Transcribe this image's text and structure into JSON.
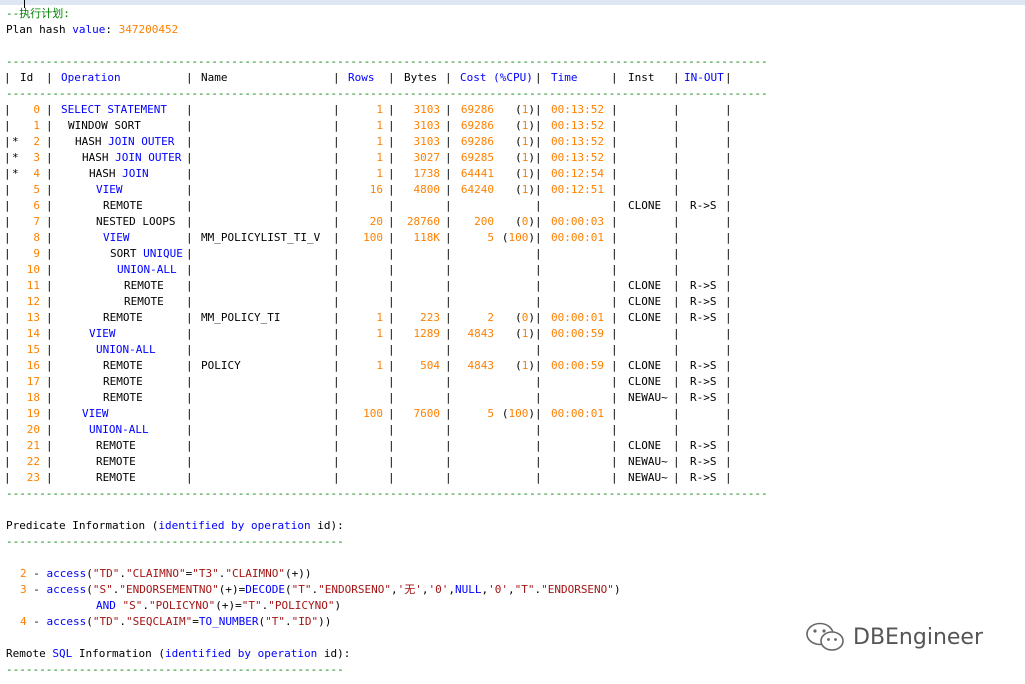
{
  "editor": {
    "comment": "--执行计划:",
    "plan_hash_label": "Plan hash ",
    "plan_hash_keyword": "value",
    "plan_hash_colon": ": ",
    "plan_hash_value": "347200452",
    "separator": "-------------------------------------------------------------------------------------------------------------------",
    "headers": [
      "Id",
      "Operation",
      "Name",
      "Rows",
      "Bytes",
      "Cost (%CPU)",
      "Time",
      "Inst",
      "IN-OUT"
    ],
    "rows": [
      {
        "star": "",
        "id": "0",
        "op": "SELECT STATEMENT",
        "indent": 0,
        "name": "",
        "rows": "1",
        "bytes": "3103",
        "cost": "69286",
        "cpu": "(1)",
        "time": "00:13:52",
        "inst": "",
        "inout": ""
      },
      {
        "star": "",
        "id": "1",
        "op": "WINDOW SORT",
        "indent": 1,
        "name": "",
        "rows": "1",
        "bytes": "3103",
        "cost": "69286",
        "cpu": "(1)",
        "time": "00:13:52",
        "inst": "",
        "inout": ""
      },
      {
        "star": "*",
        "id": "2",
        "op": "HASH JOIN OUTER",
        "indent": 2,
        "name": "",
        "rows": "1",
        "bytes": "3103",
        "cost": "69286",
        "cpu": "(1)",
        "time": "00:13:52",
        "inst": "",
        "inout": ""
      },
      {
        "star": "*",
        "id": "3",
        "op": "HASH JOIN OUTER",
        "indent": 3,
        "name": "",
        "rows": "1",
        "bytes": "3027",
        "cost": "69285",
        "cpu": "(1)",
        "time": "00:13:52",
        "inst": "",
        "inout": ""
      },
      {
        "star": "*",
        "id": "4",
        "op": "HASH JOIN",
        "indent": 4,
        "name": "",
        "rows": "1",
        "bytes": "1738",
        "cost": "64441",
        "cpu": "(1)",
        "time": "00:12:54",
        "inst": "",
        "inout": ""
      },
      {
        "star": "",
        "id": "5",
        "op": "VIEW",
        "indent": 5,
        "name": "",
        "rows": "16",
        "bytes": "4800",
        "cost": "64240",
        "cpu": "(1)",
        "time": "00:12:51",
        "inst": "",
        "inout": ""
      },
      {
        "star": "",
        "id": "6",
        "op": "REMOTE",
        "indent": 6,
        "name": "",
        "rows": "",
        "bytes": "",
        "cost": "",
        "cpu": "",
        "time": "",
        "inst": "CLONE",
        "inout": "R->S"
      },
      {
        "star": "",
        "id": "7",
        "op": "NESTED LOOPS",
        "indent": 5,
        "name": "",
        "rows": "20",
        "bytes": "28760",
        "cost": "200",
        "cpu": "(0)",
        "time": "00:00:03",
        "inst": "",
        "inout": ""
      },
      {
        "star": "",
        "id": "8",
        "op": "VIEW",
        "indent": 6,
        "name": "MM_POLICYLIST_TI_V",
        "rows": "100",
        "bytes": "118K",
        "cost": "5",
        "cpu": "(100)",
        "time": "00:00:01",
        "inst": "",
        "inout": ""
      },
      {
        "star": "",
        "id": "9",
        "op": "SORT UNIQUE",
        "indent": 7,
        "name": "",
        "rows": "",
        "bytes": "",
        "cost": "",
        "cpu": "",
        "time": "",
        "inst": "",
        "inout": ""
      },
      {
        "star": "",
        "id": "10",
        "op": "UNION-ALL",
        "indent": 8,
        "name": "",
        "rows": "",
        "bytes": "",
        "cost": "",
        "cpu": "",
        "time": "",
        "inst": "",
        "inout": ""
      },
      {
        "star": "",
        "id": "11",
        "op": "REMOTE",
        "indent": 9,
        "name": "",
        "rows": "",
        "bytes": "",
        "cost": "",
        "cpu": "",
        "time": "",
        "inst": "CLONE",
        "inout": "R->S"
      },
      {
        "star": "",
        "id": "12",
        "op": "REMOTE",
        "indent": 9,
        "name": "",
        "rows": "",
        "bytes": "",
        "cost": "",
        "cpu": "",
        "time": "",
        "inst": "CLONE",
        "inout": "R->S"
      },
      {
        "star": "",
        "id": "13",
        "op": "REMOTE",
        "indent": 6,
        "name": "MM_POLICY_TI",
        "rows": "1",
        "bytes": "223",
        "cost": "2",
        "cpu": "(0)",
        "time": "00:00:01",
        "inst": "CLONE",
        "inout": "R->S"
      },
      {
        "star": "",
        "id": "14",
        "op": "VIEW",
        "indent": 4,
        "name": "",
        "rows": "1",
        "bytes": "1289",
        "cost": "4843",
        "cpu": "(1)",
        "time": "00:00:59",
        "inst": "",
        "inout": ""
      },
      {
        "star": "",
        "id": "15",
        "op": "UNION-ALL",
        "indent": 5,
        "name": "",
        "rows": "",
        "bytes": "",
        "cost": "",
        "cpu": "",
        "time": "",
        "inst": "",
        "inout": ""
      },
      {
        "star": "",
        "id": "16",
        "op": "REMOTE",
        "indent": 6,
        "name": "POLICY",
        "rows": "1",
        "bytes": "504",
        "cost": "4843",
        "cpu": "(1)",
        "time": "00:00:59",
        "inst": "CLONE",
        "inout": "R->S"
      },
      {
        "star": "",
        "id": "17",
        "op": "REMOTE",
        "indent": 6,
        "name": "",
        "rows": "",
        "bytes": "",
        "cost": "",
        "cpu": "",
        "time": "",
        "inst": "CLONE",
        "inout": "R->S"
      },
      {
        "star": "",
        "id": "18",
        "op": "REMOTE",
        "indent": 6,
        "name": "",
        "rows": "",
        "bytes": "",
        "cost": "",
        "cpu": "",
        "time": "",
        "inst": "NEWAU~",
        "inout": "R->S"
      },
      {
        "star": "",
        "id": "19",
        "op": "VIEW",
        "indent": 3,
        "name": "",
        "rows": "100",
        "bytes": "7600",
        "cost": "5",
        "cpu": "(100)",
        "time": "00:00:01",
        "inst": "",
        "inout": ""
      },
      {
        "star": "",
        "id": "20",
        "op": "UNION-ALL",
        "indent": 4,
        "name": "",
        "rows": "",
        "bytes": "",
        "cost": "",
        "cpu": "",
        "time": "",
        "inst": "",
        "inout": ""
      },
      {
        "star": "",
        "id": "21",
        "op": "REMOTE",
        "indent": 5,
        "name": "",
        "rows": "",
        "bytes": "",
        "cost": "",
        "cpu": "",
        "time": "",
        "inst": "CLONE",
        "inout": "R->S"
      },
      {
        "star": "",
        "id": "22",
        "op": "REMOTE",
        "indent": 5,
        "name": "",
        "rows": "",
        "bytes": "",
        "cost": "",
        "cpu": "",
        "time": "",
        "inst": "NEWAU~",
        "inout": "R->S"
      },
      {
        "star": "",
        "id": "23",
        "op": "REMOTE",
        "indent": 5,
        "name": "",
        "rows": "",
        "bytes": "",
        "cost": "",
        "cpu": "",
        "time": "",
        "inst": "NEWAU~",
        "inout": "R->S"
      }
    ],
    "predicate_title_a": "Predicate Information (",
    "predicate_title_kw": "identified by operation",
    "predicate_title_b": " id):",
    "short_separator": "---------------------------------------------------",
    "predicates": [
      {
        "n": "2",
        "text_a": "access",
        "text_b": "(\"TD\".\"CLAIMNO\"=\"T3\".\"CLAIMNO\"(+))"
      },
      {
        "n": "3",
        "text_a": "access",
        "text_b": "(\"S\".\"ENDORSEMENTNO\"(+)=DECODE(\"T\".\"ENDORSENO\",'无','0',NULL,'0',\"T\".\"ENDORSENO\")"
      },
      {
        "n": "",
        "text_a": "AND",
        "text_b": " \"S\".\"POLICYNO\"(+)=\"T\".\"POLICYNO\")"
      },
      {
        "n": "4",
        "text_a": "access",
        "text_b": "(\"TD\".\"SEQCLAIM\"=TO_NUMBER(\"T\".\"ID\"))"
      }
    ],
    "remote_title_a": "Remote ",
    "remote_title_sql": "SQL",
    "remote_title_b": " Information (",
    "remote_title_kw": "identified by operation",
    "remote_title_c": " id):"
  },
  "watermark": {
    "text": "DBEngineer",
    "icon": "wechat-icon"
  },
  "colors": {
    "keyword": "#0000ff",
    "number": "#ff8000",
    "comment": "#008000"
  }
}
